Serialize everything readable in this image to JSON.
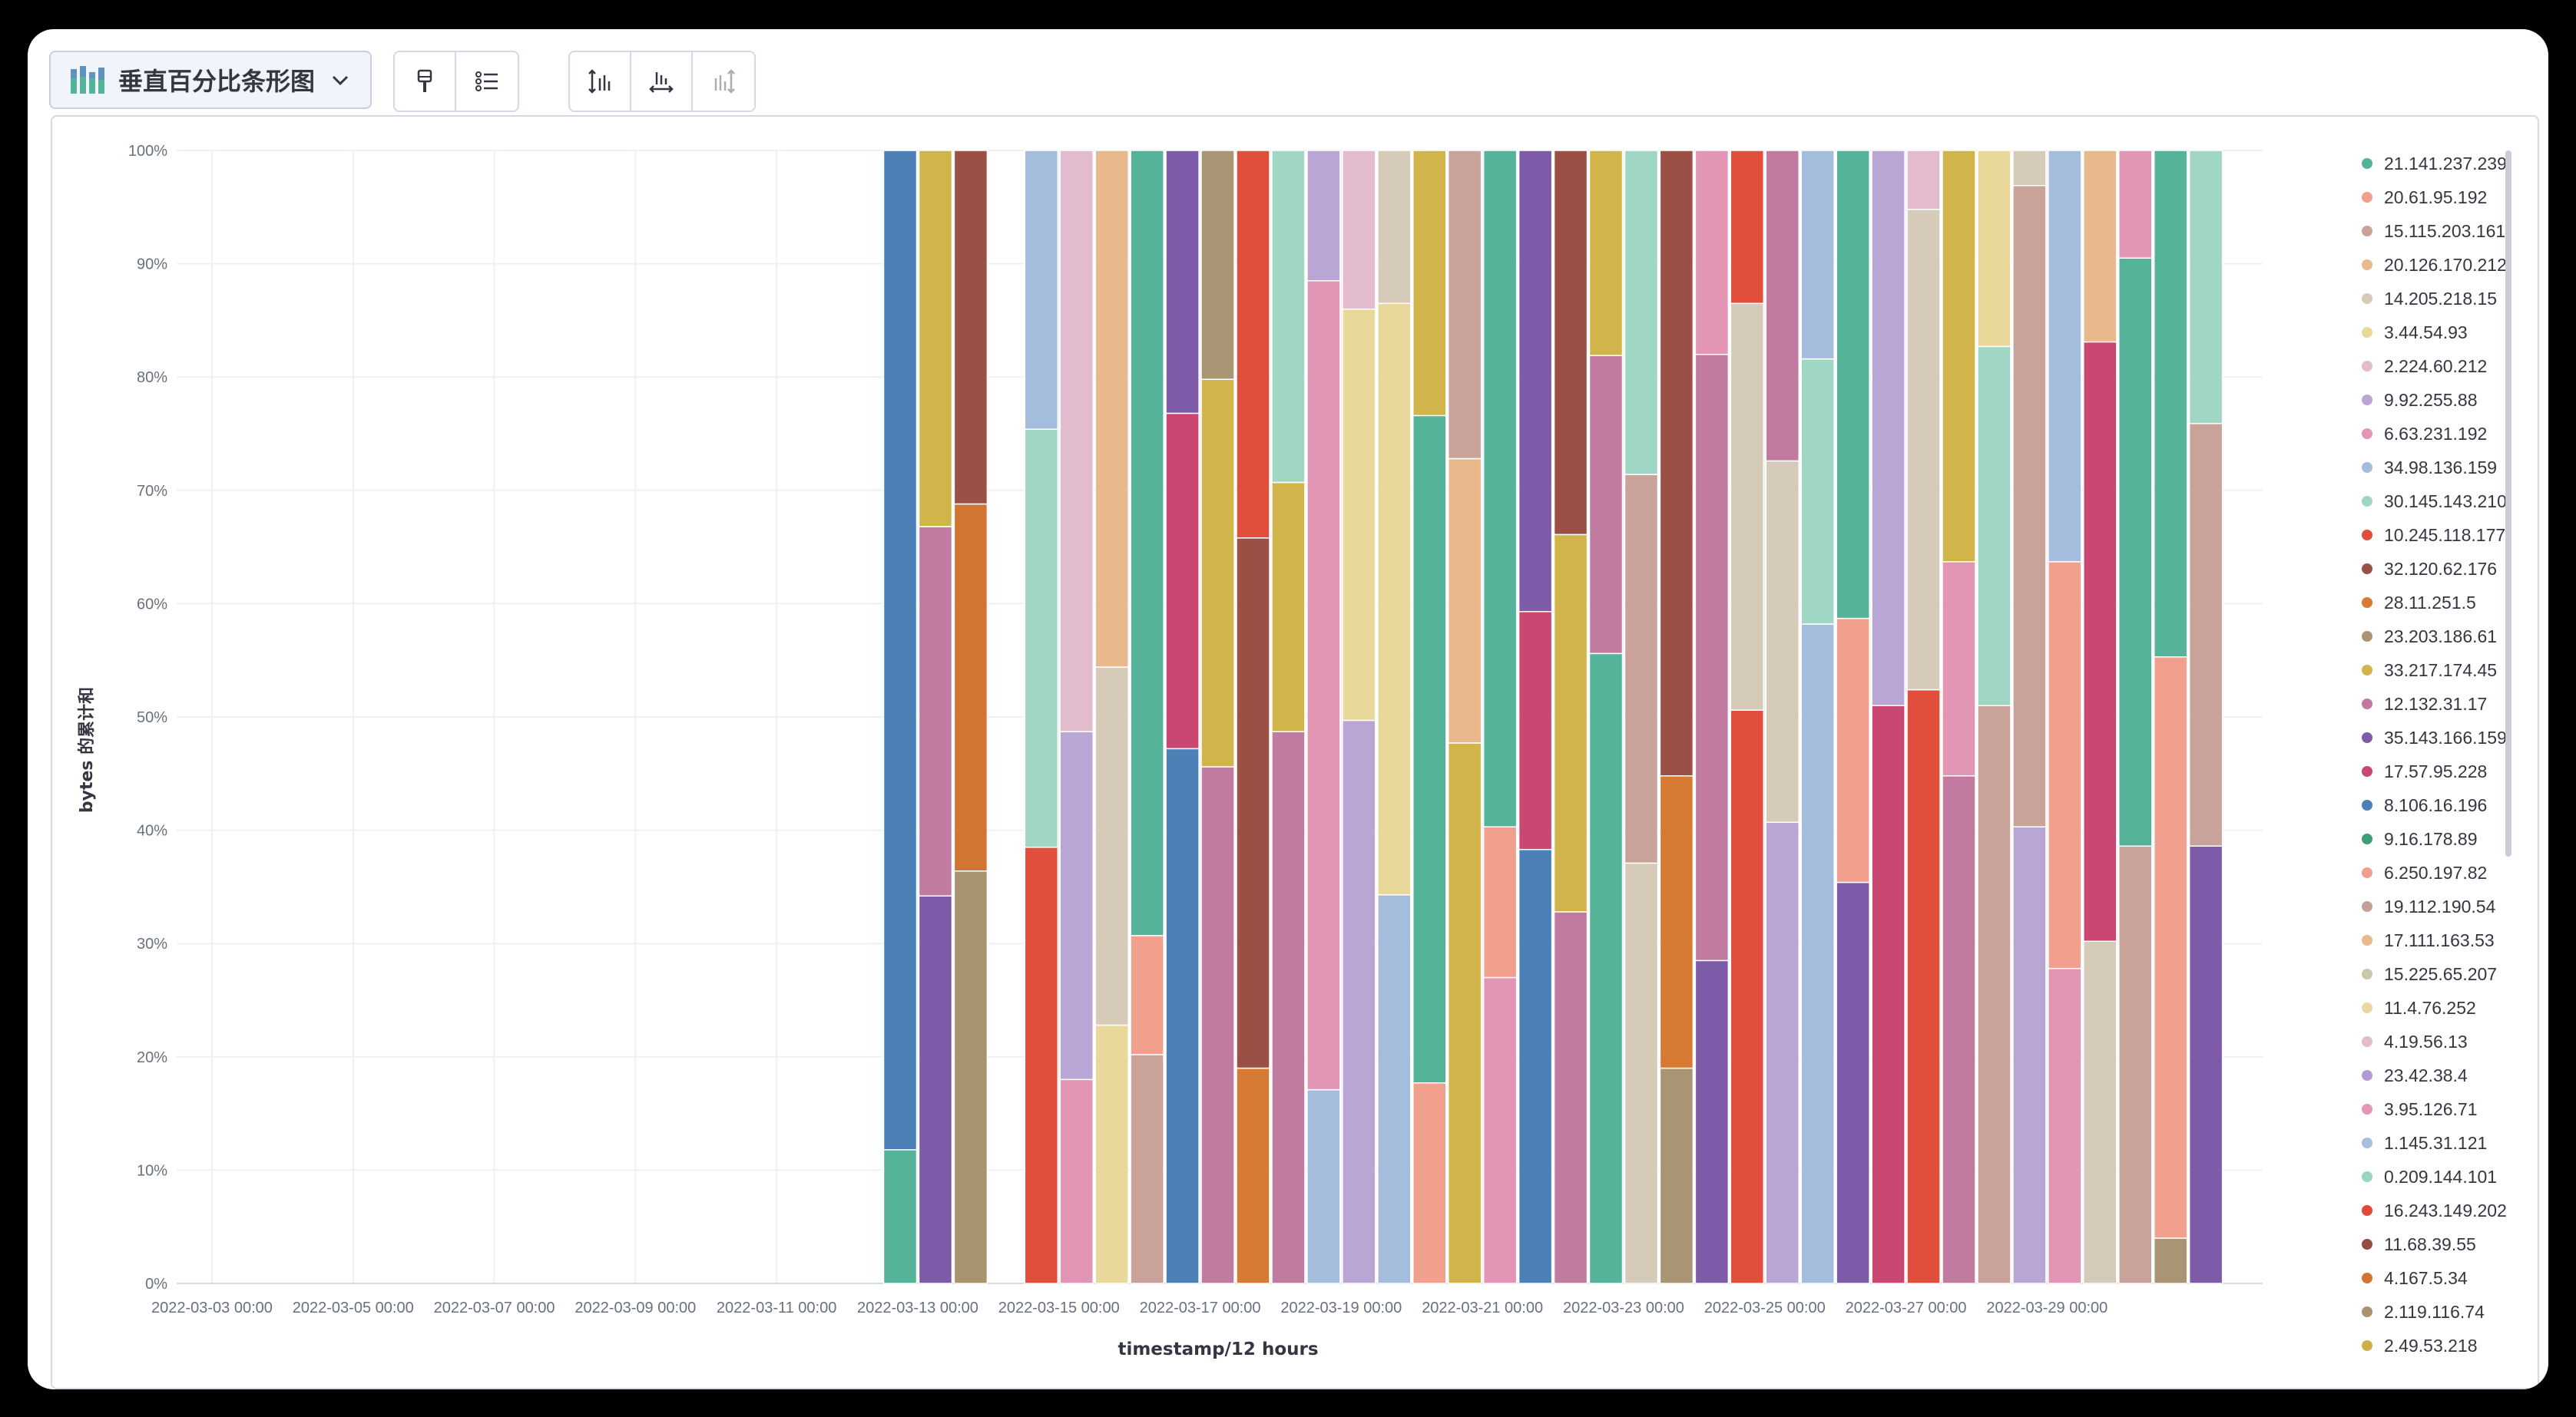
{
  "toolbar": {
    "chart_type_label": "垂直百分比条形图",
    "icons": [
      "bar-chart-icon",
      "chevron-down-icon",
      "paintbrush-icon",
      "legend-list-icon",
      "axis-left-icon",
      "axis-bottom-icon",
      "axis-right-icon"
    ]
  },
  "colors": {
    "grid": "#eef0f4",
    "text": "#343741",
    "tick": "#69707d",
    "scrollbar": "#c9ced6"
  },
  "chart_data": {
    "type": "bar",
    "stacked": "percent",
    "ylabel": "bytes 的累计和",
    "xlabel": "timestamp/12 hours",
    "ylim": [
      0,
      100
    ],
    "yticks": [
      "0%",
      "10%",
      "20%",
      "30%",
      "40%",
      "50%",
      "60%",
      "70%",
      "80%",
      "90%",
      "100%"
    ],
    "xticks": [
      "2022-03-03 00:00",
      "2022-03-05 00:00",
      "2022-03-07 00:00",
      "2022-03-09 00:00",
      "2022-03-11 00:00",
      "2022-03-13 00:00",
      "2022-03-15 00:00",
      "2022-03-17 00:00",
      "2022-03-19 00:00",
      "2022-03-21 00:00",
      "2022-03-23 00:00",
      "2022-03-25 00:00",
      "2022-03-27 00:00",
      "2022-03-29 00:00"
    ],
    "legend_position": "right",
    "grid": true,
    "series": [
      {
        "name": "21.141.237.239",
        "color": "#54b399"
      },
      {
        "name": "20.61.95.192",
        "color": "#f1a08e"
      },
      {
        "name": "15.115.203.161",
        "color": "#c9a39a"
      },
      {
        "name": "20.126.170.212",
        "color": "#e8b98c"
      },
      {
        "name": "14.205.218.15",
        "color": "#d6cbb9"
      },
      {
        "name": "3.44.54.93",
        "color": "#e8d99a"
      },
      {
        "name": "2.224.60.212",
        "color": "#e2bccd"
      },
      {
        "name": "9.92.255.88",
        "color": "#b9a6d4"
      },
      {
        "name": "6.63.231.192",
        "color": "#e295b4"
      },
      {
        "name": "34.98.136.159",
        "color": "#a5bddd"
      },
      {
        "name": "30.145.143.210",
        "color": "#9fd7c4"
      },
      {
        "name": "10.245.118.177",
        "color": "#e14f3c"
      },
      {
        "name": "32.120.62.176",
        "color": "#9a5045"
      },
      {
        "name": "28.11.251.5",
        "color": "#d67a34"
      },
      {
        "name": "23.203.186.61",
        "color": "#a99573"
      },
      {
        "name": "33.217.174.45",
        "color": "#d1b54a"
      },
      {
        "name": "12.132.31.17",
        "color": "#c17ba0"
      },
      {
        "name": "35.143.166.159",
        "color": "#7e5ba8"
      },
      {
        "name": "17.57.95.228",
        "color": "#c94770"
      },
      {
        "name": "8.106.16.196",
        "color": "#4c80b6"
      },
      {
        "name": "9.16.178.89",
        "color": "#3f9e7a"
      },
      {
        "name": "6.250.197.82",
        "color": "#f09f8f"
      },
      {
        "name": "19.112.190.54",
        "color": "#c5a09a"
      },
      {
        "name": "17.111.163.53",
        "color": "#e8b88f"
      },
      {
        "name": "15.225.65.207",
        "color": "#c9c8aa"
      },
      {
        "name": "11.4.76.252",
        "color": "#ead8a0"
      },
      {
        "name": "4.19.56.13",
        "color": "#e3bccb"
      },
      {
        "name": "23.42.38.4",
        "color": "#b39ad6"
      },
      {
        "name": "3.95.126.71",
        "color": "#e496b6"
      },
      {
        "name": "1.145.31.121",
        "color": "#a7bfdd"
      },
      {
        "name": "0.209.144.101",
        "color": "#98d5c2"
      },
      {
        "name": "16.243.149.202",
        "color": "#e1493a"
      },
      {
        "name": "11.68.39.55",
        "color": "#964b42"
      },
      {
        "name": "4.167.5.34",
        "color": "#d27432"
      },
      {
        "name": "2.119.116.74",
        "color": "#a8936f"
      },
      {
        "name": "2.49.53.218",
        "color": "#cdb148"
      }
    ],
    "bars": [
      {
        "slot": 20,
        "segments": [
          {
            "c": "#54b399",
            "v": 11.8
          },
          {
            "c": "#4c80b6",
            "v": 88.2
          }
        ]
      },
      {
        "slot": 21,
        "segments": [
          {
            "c": "#7e5ba8",
            "v": 34.2
          },
          {
            "c": "#c17ba0",
            "v": 32.6
          },
          {
            "c": "#d1b54a",
            "v": 33.2
          }
        ]
      },
      {
        "slot": 22,
        "segments": [
          {
            "c": "#a8936f",
            "v": 36.4
          },
          {
            "c": "#d27432",
            "v": 32.4
          },
          {
            "c": "#9a5045",
            "v": 31.2
          }
        ]
      },
      {
        "slot": 24,
        "segments": [
          {
            "c": "#e14f3c",
            "v": 38.5
          },
          {
            "c": "#9fd7c4",
            "v": 36.9
          },
          {
            "c": "#a5bddd",
            "v": 24.6
          }
        ]
      },
      {
        "slot": 25,
        "segments": [
          {
            "c": "#e295b4",
            "v": 18.0
          },
          {
            "c": "#b9a6d4",
            "v": 30.7
          },
          {
            "c": "#e2bccd",
            "v": 51.3
          }
        ]
      },
      {
        "slot": 26,
        "segments": [
          {
            "c": "#e8d99a",
            "v": 22.8
          },
          {
            "c": "#d6cbb9",
            "v": 31.6
          },
          {
            "c": "#e8b98c",
            "v": 45.6
          }
        ]
      },
      {
        "slot": 27,
        "segments": [
          {
            "c": "#c9a39a",
            "v": 20.2
          },
          {
            "c": "#f1a08e",
            "v": 10.5
          },
          {
            "c": "#54b399",
            "v": 69.3
          }
        ]
      },
      {
        "slot": 28,
        "segments": [
          {
            "c": "#4c80b6",
            "v": 47.2
          },
          {
            "c": "#c94770",
            "v": 29.6
          },
          {
            "c": "#7e5ba8",
            "v": 23.2
          }
        ]
      },
      {
        "slot": 29,
        "segments": [
          {
            "c": "#c17ba0",
            "v": 45.6
          },
          {
            "c": "#d1b54a",
            "v": 34.2
          },
          {
            "c": "#a99573",
            "v": 20.2
          }
        ]
      },
      {
        "slot": 30,
        "segments": [
          {
            "c": "#d67a34",
            "v": 19.0
          },
          {
            "c": "#9a5045",
            "v": 46.8
          },
          {
            "c": "#e14f3c",
            "v": 34.2
          }
        ]
      },
      {
        "slot": 31,
        "segments": [
          {
            "c": "#c17ba0",
            "v": 48.7
          },
          {
            "c": "#d1b54a",
            "v": 22.0
          },
          {
            "c": "#9fd7c4",
            "v": 29.3
          }
        ]
      },
      {
        "slot": 32,
        "segments": [
          {
            "c": "#a5bddd",
            "v": 17.1
          },
          {
            "c": "#e295b4",
            "v": 71.4
          },
          {
            "c": "#b9a6d4",
            "v": 11.5
          }
        ]
      },
      {
        "slot": 33,
        "segments": [
          {
            "c": "#b9a6d4",
            "v": 49.7
          },
          {
            "c": "#e8d99a",
            "v": 36.3
          },
          {
            "c": "#e2bccd",
            "v": 14.0
          }
        ]
      },
      {
        "slot": 34,
        "segments": [
          {
            "c": "#a5bddd",
            "v": 34.3
          },
          {
            "c": "#e8d99a",
            "v": 52.2
          },
          {
            "c": "#d6cbb9",
            "v": 13.5
          }
        ]
      },
      {
        "slot": 35,
        "segments": [
          {
            "c": "#f1a08e",
            "v": 17.7
          },
          {
            "c": "#54b399",
            "v": 58.9
          },
          {
            "c": "#d1b54a",
            "v": 23.4
          }
        ]
      },
      {
        "slot": 36,
        "segments": [
          {
            "c": "#d1b54a",
            "v": 47.7
          },
          {
            "c": "#e8b98c",
            "v": 25.1
          },
          {
            "c": "#c9a39a",
            "v": 27.2
          }
        ]
      },
      {
        "slot": 37,
        "segments": [
          {
            "c": "#e295b4",
            "v": 27.0
          },
          {
            "c": "#f1a08e",
            "v": 13.3
          },
          {
            "c": "#54b399",
            "v": 59.7
          }
        ]
      },
      {
        "slot": 38,
        "segments": [
          {
            "c": "#4c80b6",
            "v": 38.3
          },
          {
            "c": "#c94770",
            "v": 21.0
          },
          {
            "c": "#7e5ba8",
            "v": 40.7
          }
        ]
      },
      {
        "slot": 39,
        "segments": [
          {
            "c": "#c17ba0",
            "v": 32.8
          },
          {
            "c": "#d1b54a",
            "v": 33.3
          },
          {
            "c": "#9a5045",
            "v": 33.9
          }
        ]
      },
      {
        "slot": 40,
        "segments": [
          {
            "c": "#54b399",
            "v": 55.6
          },
          {
            "c": "#c17ba0",
            "v": 26.3
          },
          {
            "c": "#d1b54a",
            "v": 18.1
          }
        ]
      },
      {
        "slot": 41,
        "segments": [
          {
            "c": "#d6cbb9",
            "v": 37.1
          },
          {
            "c": "#c9a39a",
            "v": 34.3
          },
          {
            "c": "#9fd7c4",
            "v": 28.6
          }
        ]
      },
      {
        "slot": 42,
        "segments": [
          {
            "c": "#a99573",
            "v": 19.0
          },
          {
            "c": "#d67a34",
            "v": 25.8
          },
          {
            "c": "#9a5045",
            "v": 55.2
          }
        ]
      },
      {
        "slot": 43,
        "segments": [
          {
            "c": "#7e5ba8",
            "v": 28.5
          },
          {
            "c": "#c17ba0",
            "v": 53.5
          },
          {
            "c": "#e295b4",
            "v": 18.0
          }
        ]
      },
      {
        "slot": 44,
        "segments": [
          {
            "c": "#e14f3c",
            "v": 50.6
          },
          {
            "c": "#d6cbb9",
            "v": 35.9
          },
          {
            "c": "#e14f3c",
            "v": 13.5
          }
        ]
      },
      {
        "slot": 45,
        "segments": [
          {
            "c": "#b9a6d4",
            "v": 40.7
          },
          {
            "c": "#d6cbb9",
            "v": 31.9
          },
          {
            "c": "#c17ba0",
            "v": 27.4
          }
        ]
      },
      {
        "slot": 46,
        "segments": [
          {
            "c": "#a5bddd",
            "v": 58.2
          },
          {
            "c": "#9fd7c4",
            "v": 23.4
          },
          {
            "c": "#a5bddd",
            "v": 18.4
          }
        ]
      },
      {
        "slot": 47,
        "segments": [
          {
            "c": "#7e5ba8",
            "v": 35.4
          },
          {
            "c": "#f1a08e",
            "v": 23.3
          },
          {
            "c": "#54b399",
            "v": 41.3
          }
        ]
      },
      {
        "slot": 48,
        "segments": [
          {
            "c": "#c94770",
            "v": 51.0
          },
          {
            "c": "#b9a6d4",
            "v": 49.0
          }
        ]
      },
      {
        "slot": 49,
        "segments": [
          {
            "c": "#e14f3c",
            "v": 52.4
          },
          {
            "c": "#d6cbb9",
            "v": 42.4
          },
          {
            "c": "#e2bccd",
            "v": 5.2
          }
        ]
      },
      {
        "slot": 50,
        "segments": [
          {
            "c": "#c17ba0",
            "v": 44.8
          },
          {
            "c": "#e295b4",
            "v": 18.9
          },
          {
            "c": "#d1b54a",
            "v": 36.3
          }
        ]
      },
      {
        "slot": 51,
        "segments": [
          {
            "c": "#c9a39a",
            "v": 51.0
          },
          {
            "c": "#9fd7c4",
            "v": 31.7
          },
          {
            "c": "#e8d99a",
            "v": 17.3
          }
        ]
      },
      {
        "slot": 52,
        "segments": [
          {
            "c": "#b9a6d4",
            "v": 40.3
          },
          {
            "c": "#c9a39a",
            "v": 56.6
          },
          {
            "c": "#d6cbb9",
            "v": 3.1
          }
        ]
      },
      {
        "slot": 53,
        "segments": [
          {
            "c": "#e295b4",
            "v": 27.8
          },
          {
            "c": "#f1a08e",
            "v": 35.9
          },
          {
            "c": "#a5bddd",
            "v": 36.3
          }
        ]
      },
      {
        "slot": 54,
        "segments": [
          {
            "c": "#d6cbb9",
            "v": 30.2
          },
          {
            "c": "#c94770",
            "v": 52.9
          },
          {
            "c": "#e8b98c",
            "v": 16.9
          }
        ]
      },
      {
        "slot": 55,
        "segments": [
          {
            "c": "#c9a39a",
            "v": 38.6
          },
          {
            "c": "#54b399",
            "v": 51.9
          },
          {
            "c": "#e295b4",
            "v": 9.5
          }
        ]
      },
      {
        "slot": 56,
        "segments": [
          {
            "c": "#a99573",
            "v": 4.0
          },
          {
            "c": "#f1a08e",
            "v": 51.3
          },
          {
            "c": "#54b399",
            "v": 44.7
          }
        ]
      },
      {
        "slot": 57,
        "segments": [
          {
            "c": "#7e5ba8",
            "v": 38.6
          },
          {
            "c": "#c9a39a",
            "v": 37.3
          },
          {
            "c": "#9fd7c4",
            "v": 24.1
          }
        ]
      }
    ]
  }
}
